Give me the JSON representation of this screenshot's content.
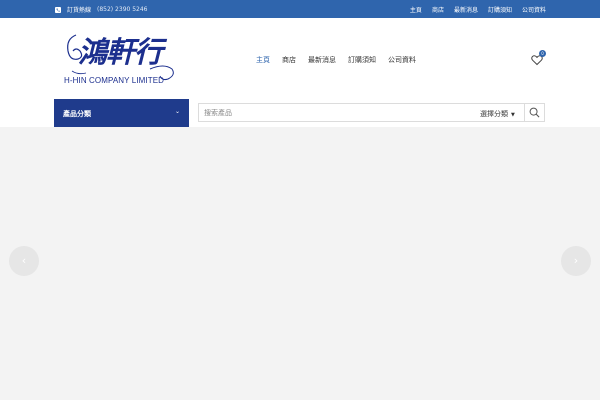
{
  "topbar": {
    "phone_label": "訂貨熱線",
    "phone_number": "(852) 2390 5246",
    "links": [
      "主頁",
      "商店",
      "最新消息",
      "訂購須知",
      "公司資料"
    ]
  },
  "logo": {
    "chars": "鴻軒行",
    "company": "H-HIN  COMPANY LIMITED"
  },
  "nav": {
    "items": [
      "主頁",
      "商店",
      "最新消息",
      "訂購須知",
      "公司資料"
    ],
    "active_index": 0
  },
  "wishlist": {
    "count": "0"
  },
  "categories": {
    "label": "產品分類"
  },
  "search": {
    "placeholder": "搜索產品",
    "select_label": "選擇分類"
  },
  "slider": {
    "prev": "‹",
    "next": "›"
  },
  "colors": {
    "topbar": "#2f65ad",
    "category_button": "#1f3b8c",
    "logo_blue": "#1c2f8e"
  }
}
